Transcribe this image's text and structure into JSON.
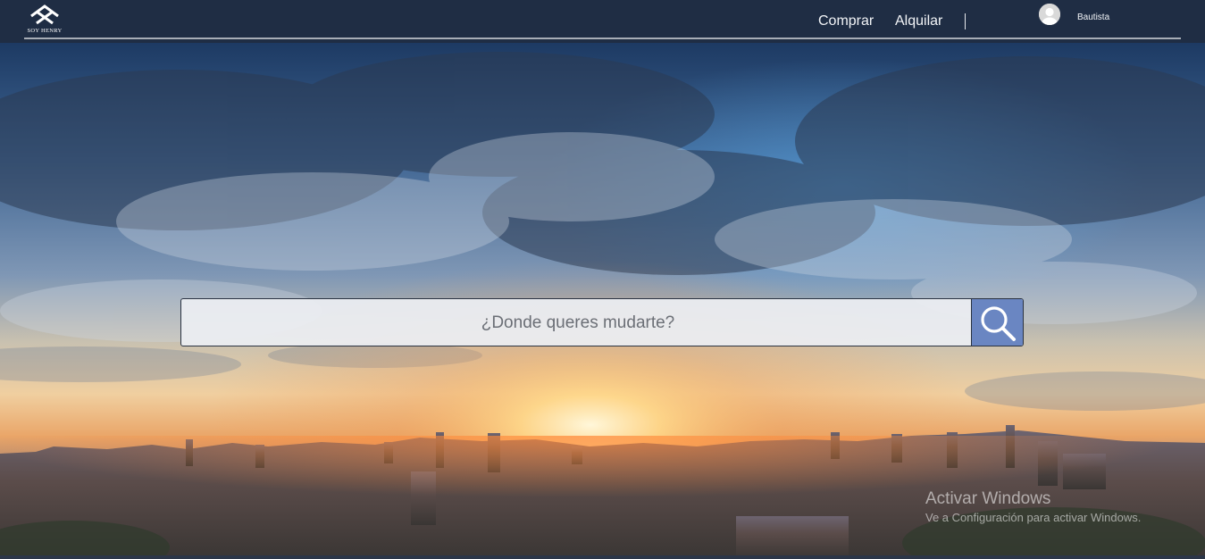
{
  "navbar": {
    "logo_text": "SOY HENRY",
    "links": [
      {
        "label": "Comprar"
      },
      {
        "label": "Alquilar"
      }
    ],
    "user": {
      "name": "Bautista",
      "icon": "user-avatar-icon"
    }
  },
  "search": {
    "placeholder": "¿Donde queres mudarte?",
    "button_icon": "search-icon"
  },
  "watermark": {
    "title": "Activar Windows",
    "subtitle": "Ve a Configuración para activar Windows."
  },
  "colors": {
    "navbar_bg": "#1f2d44",
    "search_button_bg": "#6a86c2"
  }
}
